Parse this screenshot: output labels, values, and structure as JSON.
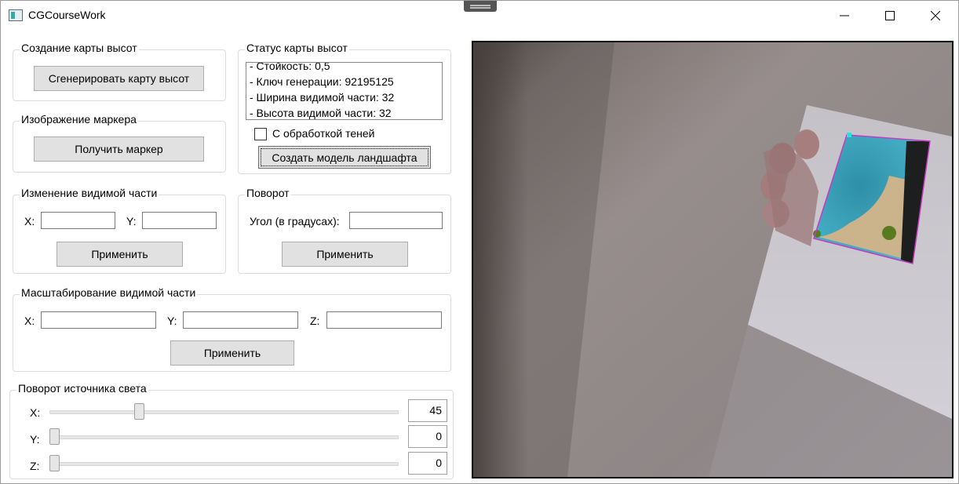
{
  "window": {
    "title": "CGCourseWork",
    "icon": "app-icon",
    "controls": [
      "minimize-icon",
      "maximize-icon",
      "close-icon"
    ]
  },
  "heightmap_create": {
    "title": "Создание карты высот",
    "generate_button": "Сгенерировать карту высот"
  },
  "heightmap_status": {
    "title": "Статус карты высот",
    "lines": [
      "- Стойкость: 0,5",
      "- Ключ генерации: 92195125",
      "- Ширина видимой части: 32",
      "- Высота видимой части: 32"
    ],
    "shadows_checkbox_label": "С обработкой теней",
    "shadows_checked": false,
    "create_model_button": "Создать модель ландшафта"
  },
  "marker": {
    "title": "Изображение маркера",
    "get_button": "Получить маркер"
  },
  "visible_part": {
    "title": "Изменение видимой части",
    "x_label": "X:",
    "y_label": "Y:",
    "x_value": "",
    "y_value": "",
    "apply_button": "Применить"
  },
  "rotation": {
    "title": "Поворот",
    "angle_label": "Угол (в градусах):",
    "angle_value": "",
    "apply_button": "Применить"
  },
  "scaling": {
    "title": "Масштабирование видимой части",
    "x_label": "X:",
    "y_label": "Y:",
    "z_label": "Z:",
    "x_value": "",
    "y_value": "",
    "z_value": "",
    "apply_button": "Применить"
  },
  "light_rotation": {
    "title": "Поворот источника света",
    "sliders": [
      {
        "label": "X:",
        "value": "45",
        "fraction": 0.25
      },
      {
        "label": "Y:",
        "value": "0",
        "fraction": 0.0
      },
      {
        "label": "Z:",
        "value": "0",
        "fraction": 0.0
      }
    ]
  },
  "camera_view": {
    "description_icon": "camera-feed-icon"
  }
}
